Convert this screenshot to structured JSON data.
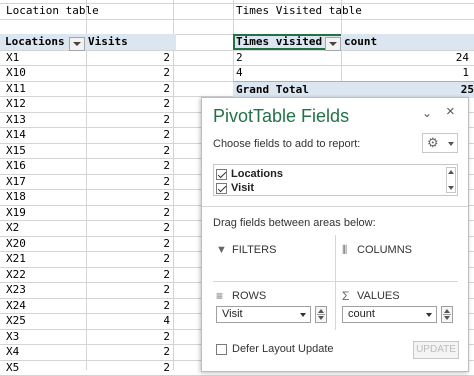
{
  "sheet": {
    "left_title": "Location table",
    "right_title": "Times Visited table",
    "left_headers": [
      "Locations",
      "Visits"
    ],
    "right_headers": [
      "Times visited",
      "count"
    ],
    "locations": [
      {
        "name": "X1",
        "visits": "2"
      },
      {
        "name": "X10",
        "visits": "2"
      },
      {
        "name": "X11",
        "visits": "2"
      },
      {
        "name": "X12",
        "visits": "2"
      },
      {
        "name": "X13",
        "visits": "2"
      },
      {
        "name": "X14",
        "visits": "2"
      },
      {
        "name": "X15",
        "visits": "2"
      },
      {
        "name": "X16",
        "visits": "2"
      },
      {
        "name": "X17",
        "visits": "2"
      },
      {
        "name": "X18",
        "visits": "2"
      },
      {
        "name": "X19",
        "visits": "2"
      },
      {
        "name": "X2",
        "visits": "2"
      },
      {
        "name": "X20",
        "visits": "2"
      },
      {
        "name": "X21",
        "visits": "2"
      },
      {
        "name": "X22",
        "visits": "2"
      },
      {
        "name": "X23",
        "visits": "2"
      },
      {
        "name": "X24",
        "visits": "2"
      },
      {
        "name": "X25",
        "visits": "4"
      },
      {
        "name": "X3",
        "visits": "2"
      },
      {
        "name": "X4",
        "visits": "2"
      },
      {
        "name": "X5",
        "visits": "2"
      }
    ],
    "pivot_rows": [
      {
        "label": "2",
        "count": "24"
      },
      {
        "label": "4",
        "count": "1"
      }
    ],
    "grand_total_label": "Grand Total",
    "grand_total": "25"
  },
  "pane": {
    "title": "PivotTable Fields",
    "close": "×",
    "menu": "⌄",
    "choose_label": "Choose fields to add to report:",
    "fields": [
      {
        "label": "Locations",
        "checked": true
      },
      {
        "label": "Visit",
        "checked": true
      }
    ],
    "drag_label": "Drag fields between areas below:",
    "areas": {
      "filters": "FILTERS",
      "columns": "COLUMNS",
      "rows": "ROWS",
      "values": "VALUES"
    },
    "rows_field": "Visit",
    "values_field": "count",
    "defer_label": "Defer Layout Update",
    "update_label": "UPDATE"
  }
}
